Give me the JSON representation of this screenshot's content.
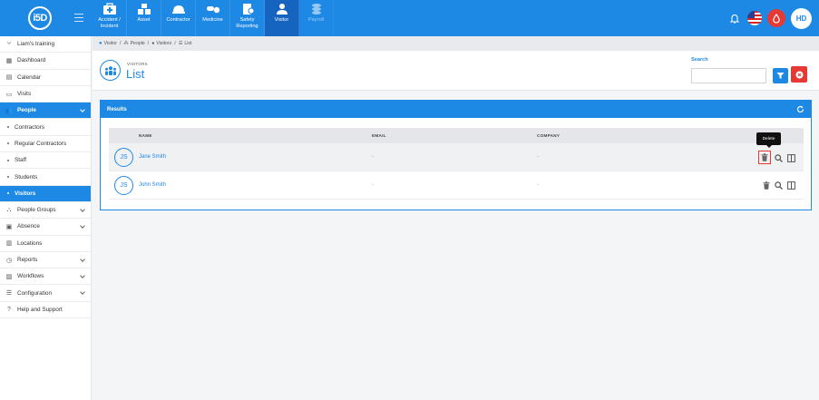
{
  "app": {
    "logo_text": "i5D",
    "user_initials": "HD"
  },
  "modules": [
    {
      "label": "Accident / Incident",
      "icon": "first-aid-icon",
      "active": false,
      "disabled": false
    },
    {
      "label": "Asset",
      "icon": "asset-icon",
      "active": false,
      "disabled": false
    },
    {
      "label": "Contractor",
      "icon": "hard-hat-icon",
      "active": false,
      "disabled": false
    },
    {
      "label": "Medicine",
      "icon": "pills-icon",
      "active": false,
      "disabled": false
    },
    {
      "label": "Safety Reporting",
      "icon": "clipboard-icon",
      "active": false,
      "disabled": false
    },
    {
      "label": "Visitor",
      "icon": "user-icon",
      "active": true,
      "disabled": false
    },
    {
      "label": "Payroll",
      "icon": "coins-icon",
      "active": false,
      "disabled": true
    }
  ],
  "sidebar": {
    "items": [
      {
        "label": "Liam's training",
        "icon": "branch-icon"
      },
      {
        "label": "Dashboard",
        "icon": "dashboard-icon"
      },
      {
        "label": "Calendar",
        "icon": "calendar-icon"
      },
      {
        "label": "Visits",
        "icon": "visits-icon"
      },
      {
        "label": "People",
        "icon": "people-icon"
      },
      {
        "label": "Contractors"
      },
      {
        "label": "Regular Contractors"
      },
      {
        "label": "Staff"
      },
      {
        "label": "Students"
      },
      {
        "label": "Visitors"
      },
      {
        "label": "People Groups",
        "icon": "people-groups-icon"
      },
      {
        "label": "Absence",
        "icon": "absence-icon"
      },
      {
        "label": "Locations",
        "icon": "locations-icon"
      },
      {
        "label": "Reports",
        "icon": "reports-icon"
      },
      {
        "label": "Workflows",
        "icon": "workflows-icon"
      },
      {
        "label": "Configuration",
        "icon": "configuration-icon"
      },
      {
        "label": "Help and Support",
        "icon": "help-icon"
      }
    ]
  },
  "breadcrumb": [
    "Visitor",
    "People",
    "Visitors",
    "List"
  ],
  "header": {
    "subtitle": "VISITORS",
    "title": "List"
  },
  "search": {
    "label": "Search",
    "value": "",
    "placeholder": ""
  },
  "results": {
    "title": "Results",
    "columns": [
      "NAME",
      "EMAIL",
      "COMPANY"
    ],
    "rows": [
      {
        "initials": "JS",
        "name": "Jane Smith",
        "email": "-",
        "company": "-"
      },
      {
        "initials": "JS",
        "name": "John Smith",
        "email": "-",
        "company": "-"
      }
    ]
  },
  "tooltip": {
    "text": "Delete"
  },
  "colors": {
    "primary": "#1e88e5",
    "danger": "#e53935",
    "active_module": "#1565c0"
  }
}
